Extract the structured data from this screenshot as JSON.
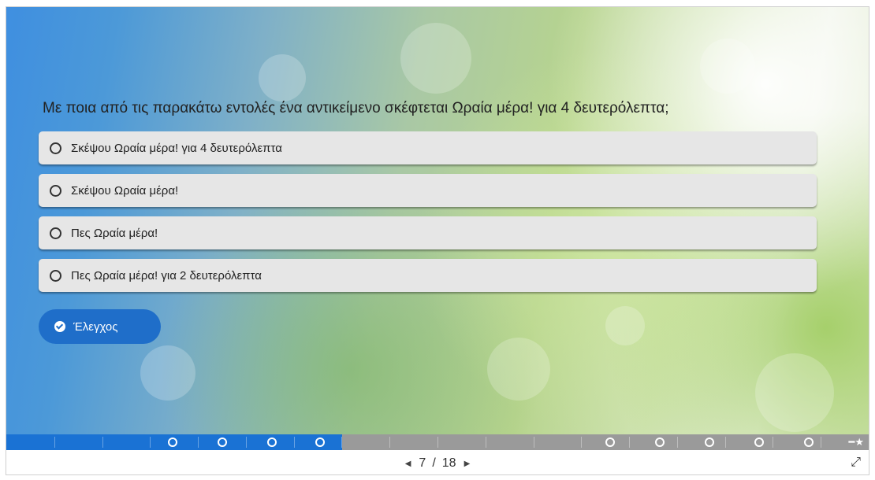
{
  "question": "Με ποια από τις παρακάτω εντολές ένα αντικείμενο σκέφτεται Ωραία μέρα! για 4 δευτερόλεπτα;",
  "answers": [
    {
      "label": "Σκέψου Ωραία μέρα! για 4 δευτερόλεπτα",
      "icon": "radio-icon"
    },
    {
      "label": "Σκέψου Ωραία μέρα!",
      "icon": "radio-icon"
    },
    {
      "label": "Πες Ωραία μέρα!",
      "icon": "radio-icon"
    },
    {
      "label": "Πες Ωραία μέρα! για 2 δευτερόλεπτα",
      "icon": "radio-icon"
    }
  ],
  "check_button": {
    "label": "Έλεγχος",
    "icon": "check-circle-icon"
  },
  "progress": {
    "current": 7,
    "total": 18,
    "fraction": 0.389
  },
  "navigation": {
    "current": "7",
    "separator": "/",
    "total": "18",
    "prev_icon": "caret-left-icon",
    "next_icon": "caret-right-icon"
  },
  "fullscreen_icon": "expand-icon",
  "colors": {
    "accent": "#1f6ec9",
    "progress_fill": "#1a72d4",
    "progress_track": "#9a9a9a"
  }
}
